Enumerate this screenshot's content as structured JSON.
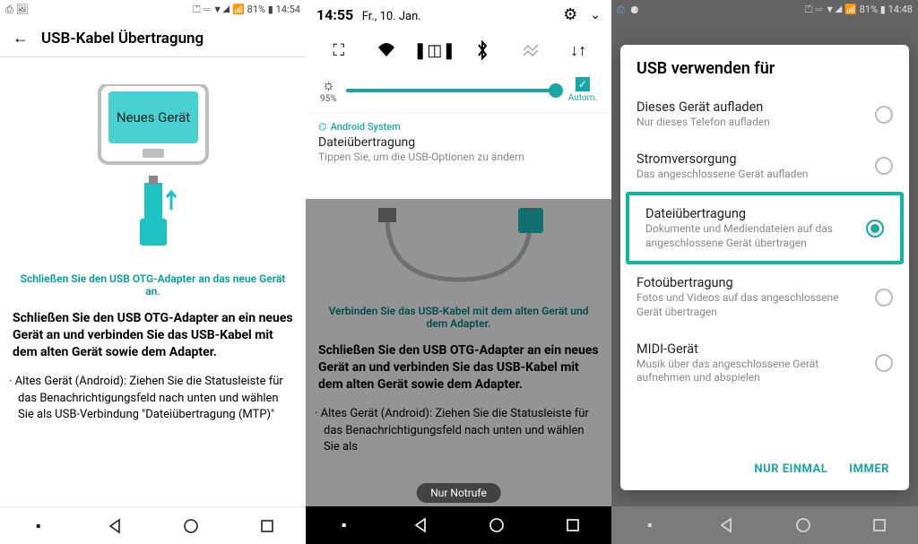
{
  "screen1": {
    "status": {
      "left_icons": "⎙  🖼",
      "right": "⏍ ⚍ ▼◢ 📶 81% ▮ 14:54"
    },
    "title": "USB-Kabel Übertragung",
    "device_label": "Neues Gerät",
    "teal_line": "Schließen Sie den USB OTG-Adapter an das neue Gerät an.",
    "bold_para": "Schließen Sie den USB OTG-Adapter an ein neues Gerät an und verbinden Sie das USB-Kabel mit dem alten Gerät sowie dem Adapter.",
    "bullet1": "Altes Gerät (Android): Ziehen Sie die Statusleiste für das Benachrichtigungsfeld nach unten und wählen Sie als USB-Verbindung \"Dateiübertragung (MTP)\""
  },
  "screen2": {
    "time": "14:55",
    "date": "Fr., 10. Jan.",
    "brightness_pct": "95%",
    "auto_label": "Autom.",
    "notif_app": "Android System",
    "notif_title": "Dateiübertragung",
    "notif_sub": "Tippen Sie, um die USB-Optionen zu ändern",
    "bg_teal": "Verbinden Sie das USB-Kabel mit dem alten Gerät und dem Adapter.",
    "bg_bold": "Schließen Sie den USB OTG-Adapter an ein neues Gerät an und verbinden Sie das USB-Kabel mit dem alten Gerät sowie dem Adapter.",
    "bg_bullet": "Altes Gerät (Android): Ziehen Sie die Statusleiste für das Benachrichtigungsfeld nach unten und wählen Sie als",
    "toast": "Nur Notrufe"
  },
  "screen3": {
    "status_right": "⏍ ⚍ ▼◢ 📶 81% ▮ 14:48",
    "dialog_title": "USB verwenden für",
    "options": [
      {
        "title": "Dieses Gerät aufladen",
        "sub": "Nur dieses Telefon aufladen",
        "selected": false
      },
      {
        "title": "Stromversorgung",
        "sub": "Das angeschlossene Gerät aufladen",
        "selected": false
      },
      {
        "title": "Dateiübertragung",
        "sub": "Dokumente und Mediendateien auf das angeschlossene Gerät übertragen",
        "selected": true
      },
      {
        "title": "Fotoübertragung",
        "sub": "Fotos und Videos auf das angeschlossene Gerät übertragen",
        "selected": false
      },
      {
        "title": "MIDI-Gerät",
        "sub": "Musik über das angeschlossene Gerät aufnehmen und abspielen",
        "selected": false
      }
    ],
    "btn_once": "NUR EINMAL",
    "btn_always": "IMMER"
  }
}
